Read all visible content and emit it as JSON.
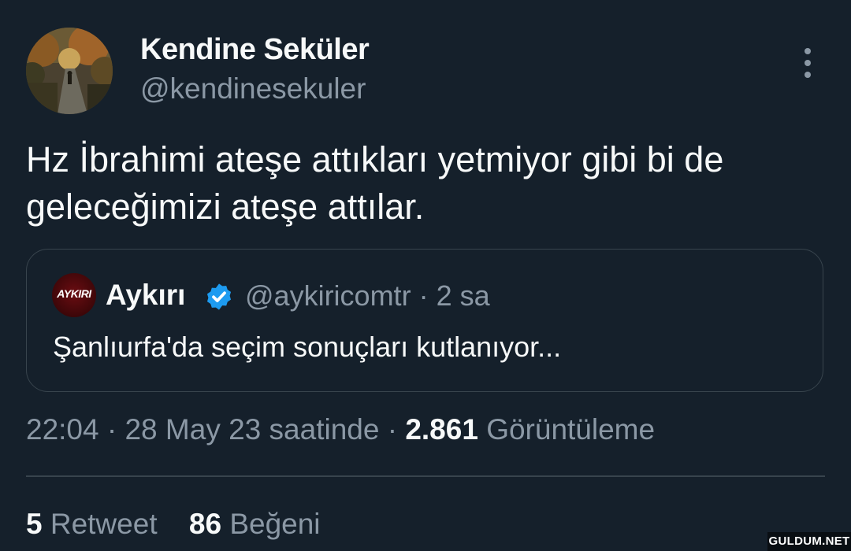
{
  "author": {
    "display_name": "Kendine Seküler",
    "handle": "@kendinesekuler"
  },
  "tweet": {
    "text": "Hz İbrahimi ateşe attıkları yetmiyor gibi bi de geleceğimizi ateşe attılar."
  },
  "quoted_tweet": {
    "avatar_text": "AYKIRI",
    "display_name": "Aykırı",
    "handle": "@aykiricomtr",
    "separator": "·",
    "time_ago": "2 sa",
    "text": "Şanlıurfa'da seçim sonuçları kutlanıyor..."
  },
  "meta": {
    "time": "22:04",
    "separator": "·",
    "date": "28 May 23 saatinde",
    "views_count": "2.861",
    "views_label": "Görüntüleme"
  },
  "stats": {
    "retweets_count": "5",
    "retweets_label": "Retweet",
    "likes_count": "86",
    "likes_label": "Beğeni"
  },
  "watermark": "GULDUM.NET",
  "icons": {
    "more": "more-vertical-icon",
    "verified": "verified-badge-icon"
  },
  "colors": {
    "background": "#15202b",
    "text_primary": "#f7f9f9",
    "text_secondary": "#8b98a5",
    "border": "#38444d",
    "verified_blue": "#1d9bf0"
  }
}
